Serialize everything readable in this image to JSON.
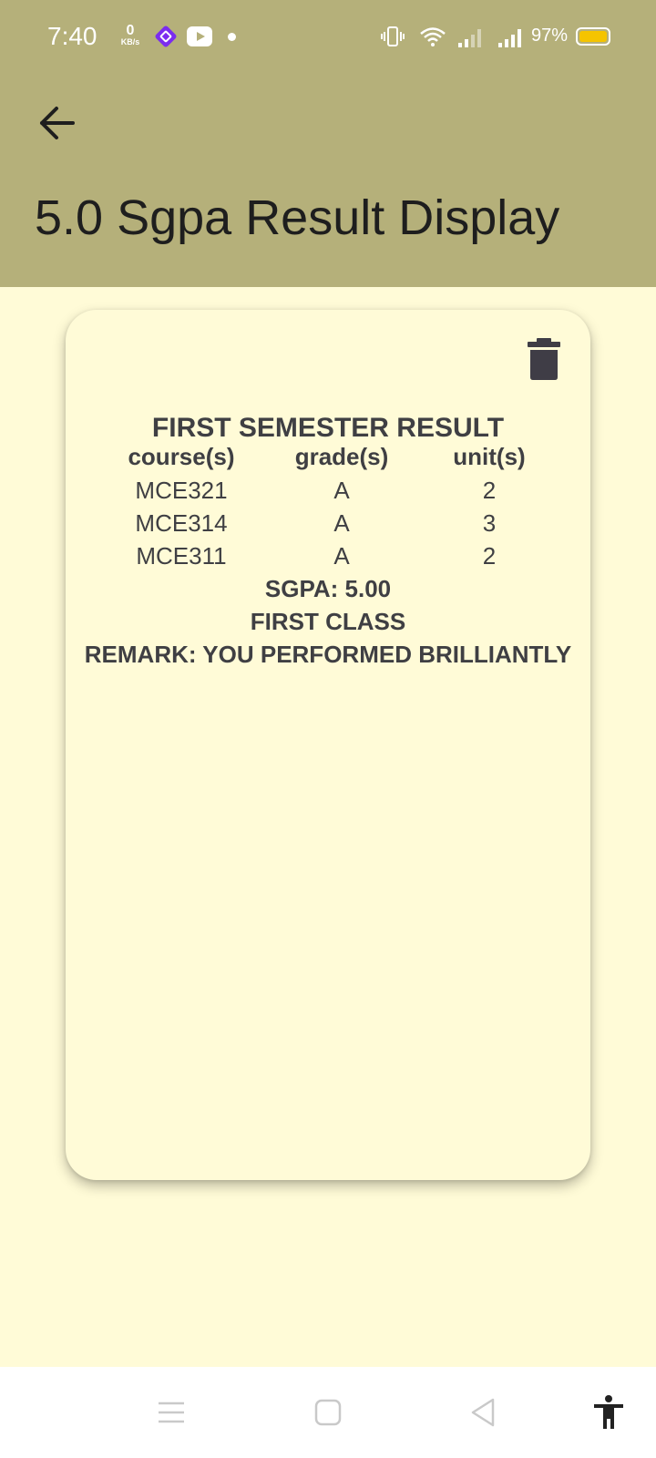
{
  "status_bar": {
    "time": "7:40",
    "net_speed_value": "0",
    "net_speed_unit": "KB/s",
    "battery_percent": "97%",
    "icons": [
      "app-notification-icon",
      "youtube-icon",
      "dot-icon",
      "vibrate-icon",
      "wifi-icon",
      "signal-icon",
      "signal-icon",
      "battery-icon"
    ],
    "battery_color": "#f5c400"
  },
  "app_bar": {
    "title": "5.0 Sgpa Result Display",
    "back_icon": "arrow-back-icon",
    "color": "#b5b07a"
  },
  "card": {
    "delete_icon": "trash-icon",
    "heading": "FIRST SEMESTER RESULT",
    "columns": [
      "course(s)",
      "grade(s)",
      "unit(s)"
    ],
    "rows": [
      {
        "course": "MCE321",
        "grade": "A",
        "unit": "2"
      },
      {
        "course": "MCE314",
        "grade": "A",
        "unit": "3"
      },
      {
        "course": "MCE311",
        "grade": "A",
        "unit": "2"
      }
    ],
    "sgpa": "SGPA: 5.00",
    "class": "FIRST CLASS",
    "remark": "REMARK: YOU PERFORMED BRILLIANTLY",
    "background": "#fffbd7"
  },
  "nav_bar": {
    "icons": [
      "menu-icon",
      "home-icon",
      "back-icon",
      "accessibility-icon"
    ]
  }
}
